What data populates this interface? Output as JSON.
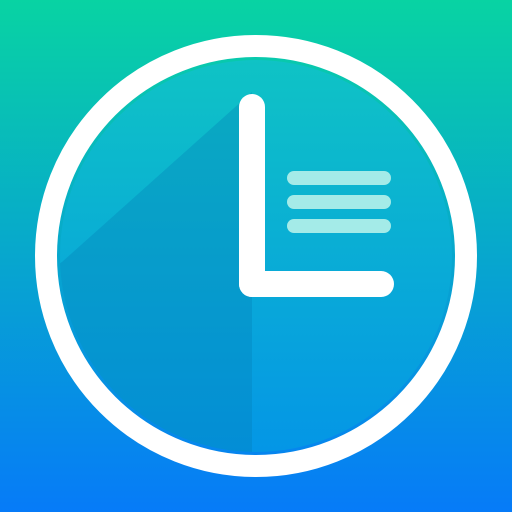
{
  "icon": {
    "name": "clock-list-app-icon",
    "symbol": "clock-icon",
    "list_symbol": "list-lines-icon",
    "list_line_count": 3
  },
  "colors": {
    "background_top": "#08d3a3",
    "background_bottom": "#067bf8",
    "face_top": "#0fc3c5",
    "face_bottom": "#0496e6",
    "face_shadow": "#047db4",
    "ring": "#ffffff",
    "hands": "#ffffff",
    "list_lines": "#a4ebe8"
  }
}
